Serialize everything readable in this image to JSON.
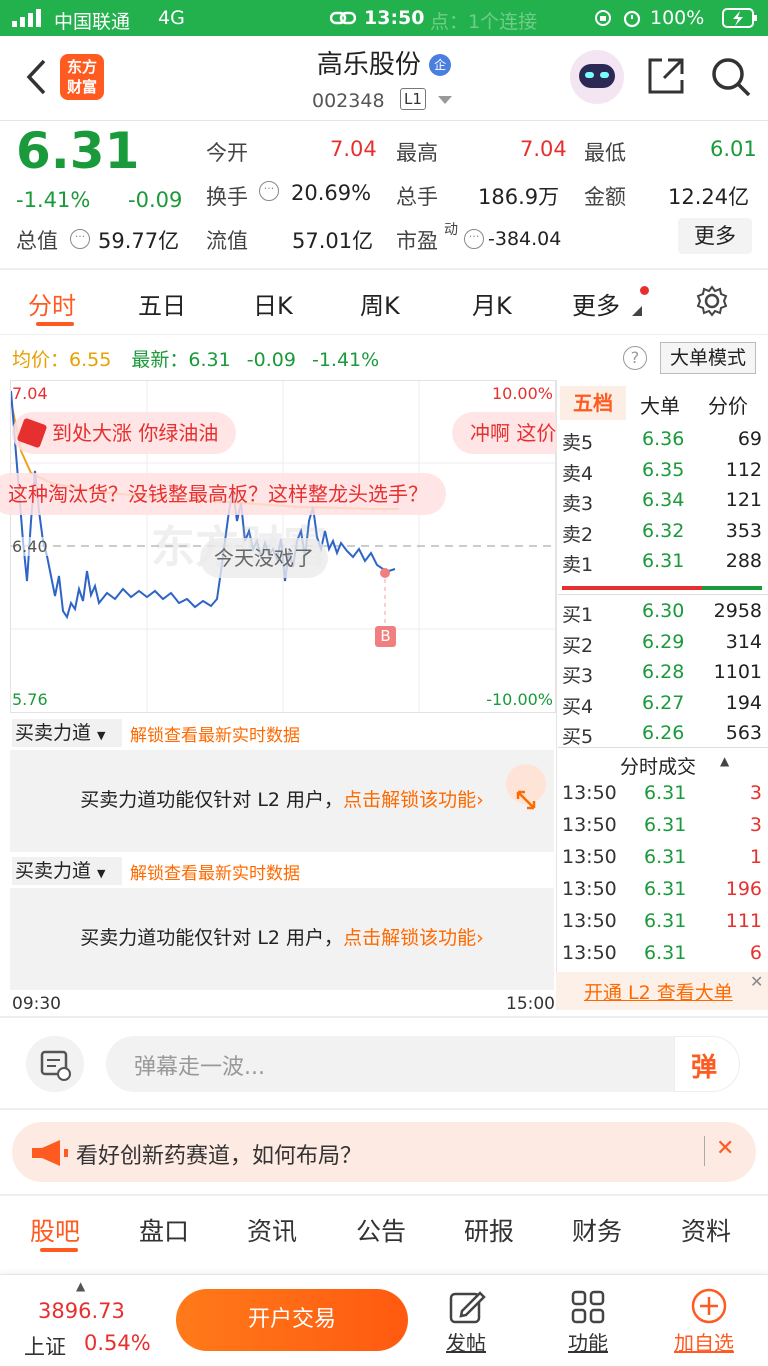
{
  "status": {
    "carrier": "中国联通",
    "network": "4G",
    "time": "13:50",
    "ghost": "点：1个连接",
    "battery": "100%"
  },
  "header": {
    "logo_line1": "东方",
    "logo_line2": "财富",
    "stock_name": "高乐股份",
    "badge": "企",
    "code": "002348",
    "level": "L1"
  },
  "quote": {
    "price": "6.31",
    "pct": "-1.41%",
    "chg": "-0.09",
    "open_label": "今开",
    "open": "7.04",
    "high_label": "最高",
    "high": "7.04",
    "low_label": "最低",
    "low": "6.01",
    "turnover_label": "换手",
    "turnover": "20.69%",
    "vol_label": "总手",
    "vol": "186.9万",
    "amt_label": "金额",
    "amt": "12.24亿",
    "mcap_label": "总值",
    "mcap": "59.77亿",
    "float_label": "流值",
    "float": "57.01亿",
    "pe_label": "市盈",
    "pe_sup": "动",
    "pe": "-384.04",
    "more": "更多"
  },
  "tabs": [
    "分时",
    "五日",
    "日K",
    "周K",
    "月K",
    "更多"
  ],
  "infobar": {
    "avg_label": "均价：",
    "avg": "6.55",
    "latest_label": "最新：",
    "latest": "6.31",
    "chg": "-0.09",
    "pct": "-1.41%",
    "bigorder": "大单模式"
  },
  "chart": {
    "top_price": "7.04",
    "mid_price": "6.40",
    "bottom_price": "5.76",
    "top_pct": "10.00%",
    "bottom_pct": "-10.00%",
    "start_time": "09:30",
    "end_time": "15:00",
    "marker": "B",
    "watermark": "东方财富"
  },
  "danmu": [
    "到处大涨 你绿油油",
    "冲啊 这价",
    "这种淘汰货？没钱整最高板？这样整龙头选手？",
    "今天没戏了"
  ],
  "lock": {
    "dropdown": "买卖力道",
    "hint": "解锁查看最新实时数据",
    "msg": "买卖力道功能仅针对 L2 用户，",
    "link": "点击解锁该功能"
  },
  "orderbook": {
    "tabs": [
      "五档",
      "大单",
      "分价"
    ],
    "asks": [
      {
        "label": "卖5",
        "price": "6.36",
        "vol": "69"
      },
      {
        "label": "卖4",
        "price": "6.35",
        "vol": "112"
      },
      {
        "label": "卖3",
        "price": "6.34",
        "vol": "121"
      },
      {
        "label": "卖2",
        "price": "6.32",
        "vol": "353"
      },
      {
        "label": "卖1",
        "price": "6.31",
        "vol": "288"
      }
    ],
    "bids": [
      {
        "label": "买1",
        "price": "6.30",
        "vol": "2958"
      },
      {
        "label": "买2",
        "price": "6.29",
        "vol": "314"
      },
      {
        "label": "买3",
        "price": "6.28",
        "vol": "1101"
      },
      {
        "label": "买4",
        "price": "6.27",
        "vol": "194"
      },
      {
        "label": "买5",
        "price": "6.26",
        "vol": "563"
      }
    ]
  },
  "trades": {
    "title": "分时成交",
    "rows": [
      {
        "t": "13:50",
        "p": "6.31",
        "v": "3"
      },
      {
        "t": "13:50",
        "p": "6.31",
        "v": "3"
      },
      {
        "t": "13:50",
        "p": "6.31",
        "v": "1"
      },
      {
        "t": "13:50",
        "p": "6.31",
        "v": "196"
      },
      {
        "t": "13:50",
        "p": "6.31",
        "v": "111"
      },
      {
        "t": "13:50",
        "p": "6.31",
        "v": "6"
      }
    ],
    "l2": "开通 L2 查看大单"
  },
  "comment": {
    "placeholder": "弹幕走一波...",
    "btn": "弹"
  },
  "ad": {
    "text": "看好创新药赛道，如何布局？"
  },
  "bottom_tabs": [
    "股吧",
    "盘口",
    "资讯",
    "公告",
    "研报",
    "财务",
    "资料"
  ],
  "bottombar": {
    "index_value": "3896.73",
    "index_name": "上证",
    "index_pct": "0.54%",
    "trade": "开户交易",
    "post": "发帖",
    "func": "功能",
    "add": "加自选"
  },
  "colors": {
    "up": "#e6302f",
    "down": "#1a9a3a",
    "accent": "#ff6a00",
    "status_bar": "#22b14c"
  }
}
